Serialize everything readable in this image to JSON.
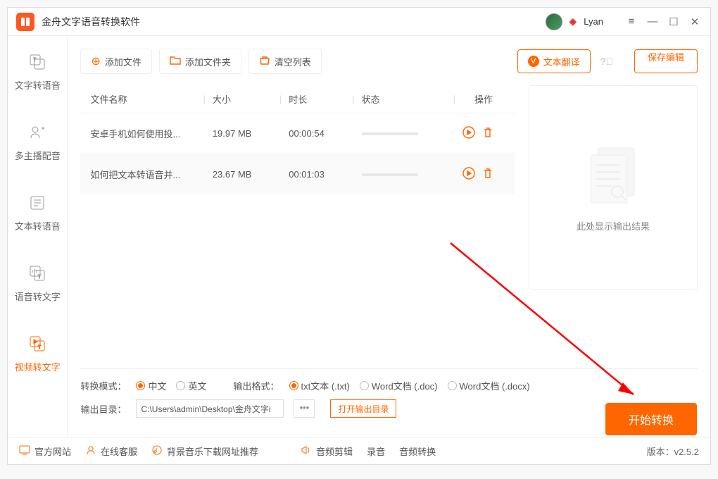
{
  "app": {
    "title": "金舟文字语音转换软件"
  },
  "user": {
    "name": "Lyan"
  },
  "sidebar": {
    "items": [
      {
        "label": "文字转语音"
      },
      {
        "label": "多主播配音"
      },
      {
        "label": "文本转语音"
      },
      {
        "label": "语音转文字"
      },
      {
        "label": "视频转文字"
      }
    ]
  },
  "toolbar": {
    "add_file": "添加文件",
    "add_folder": "添加文件夹",
    "clear_list": "清空列表",
    "text_translate": "文本翻译",
    "save_edit": "保存编辑"
  },
  "table": {
    "headers": {
      "name": "文件名称",
      "size": "大小",
      "duration": "时长",
      "status": "状态",
      "action": "操作"
    },
    "rows": [
      {
        "name": "安卓手机如何使用投...",
        "size": "19.97 MB",
        "duration": "00:00:54"
      },
      {
        "name": "如何把文本转语音并...",
        "size": "23.67 MB",
        "duration": "00:01:03"
      }
    ]
  },
  "output": {
    "placeholder": "此处显示输出结果"
  },
  "options": {
    "mode_label": "转换模式：",
    "mode_cn": "中文",
    "mode_en": "英文",
    "format_label": "输出格式：",
    "fmt_txt": "txt文本 (.txt)",
    "fmt_doc": "Word文档 (.doc)",
    "fmt_docx": "Word文档 (.docx)",
    "dir_label": "输出目录：",
    "dir_value": "C:\\Users\\admin\\Desktop\\金舟文字i",
    "open_dir": "打开输出目录"
  },
  "start": {
    "label": "开始转换"
  },
  "statusbar": {
    "site": "官方网站",
    "support": "在线客服",
    "bgm": "背景音乐下载网址推荐",
    "audio_cut": "音频剪辑",
    "record": "录音",
    "audio_convert": "音频转换",
    "version_label": "版本：",
    "version": "v2.5.2"
  }
}
